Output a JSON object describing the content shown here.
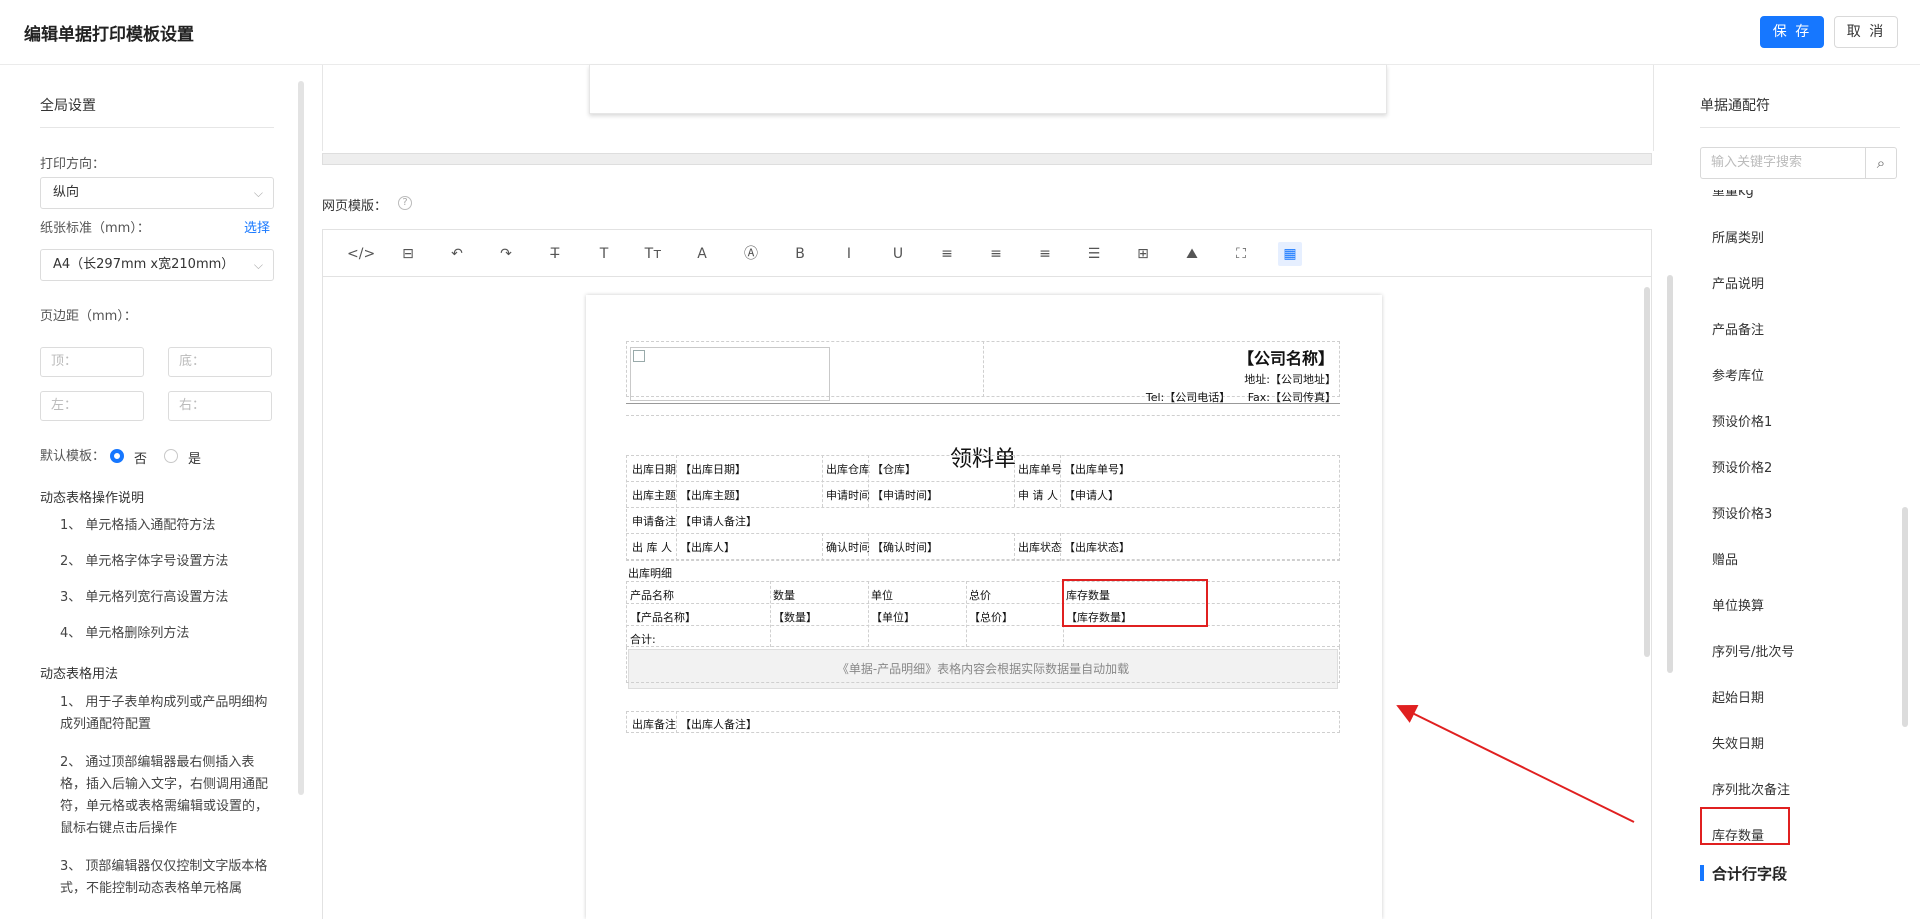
{
  "header": {
    "title": "编辑单据打印模板设置",
    "save_label": "保 存",
    "cancel_label": "取 消"
  },
  "left": {
    "section_title": "全局设置",
    "orientation_label": "打印方向：",
    "orientation_value": "纵向",
    "paper_label": "纸张标准（mm）：",
    "paper_link": "选择",
    "paper_value": "A4（长297mm x宽210mm）",
    "margin_label": "页边距（mm）：",
    "margin_top": "顶：",
    "margin_bottom": "底：",
    "margin_left": "左：",
    "margin_right": "右：",
    "default_label": "默认模板：",
    "default_no": "否",
    "default_yes": "是",
    "help1_title": "动态表格操作说明",
    "help1_items": [
      "1、 单元格插入通配符方法",
      "2、 单元格字体字号设置方法",
      "3、 单元格列宽行高设置方法",
      "4、 单元格删除列方法"
    ],
    "help2_title": "动态表格用法",
    "help2_items": [
      "1、 用于子表单构成列或产品明细构成列通配符配置",
      "2、 通过顶部编辑器最右侧插入表格，插入后输入文字，右侧调用通配符，单元格或表格需编辑或设置的，鼠标右键点击后操作",
      "3、 顶部编辑器仅仅控制文字版本格式，不能控制动态表格单元格属"
    ]
  },
  "middle": {
    "web_template_label": "网页模版：",
    "qmark": "?"
  },
  "toolbar_icons": [
    "code-icon",
    "template-icon",
    "undo-icon",
    "redo-icon",
    "strikethrough-icon",
    "text-icon",
    "font-size-icon",
    "font-color-icon",
    "bg-color-icon",
    "bold-icon",
    "italic-icon",
    "underline-icon",
    "align-left-icon",
    "align-center-icon",
    "align-right-icon",
    "justify-icon",
    "table-icon",
    "image-icon",
    "fullscreen-icon",
    "dynamic-table-icon"
  ],
  "toolbar_glyphs": [
    "</>",
    "⊟",
    "↶",
    "↷",
    "T̶",
    "T",
    "Tт",
    "A",
    "Ⓐ",
    "B",
    "I",
    "U",
    "≡",
    "≡",
    "≡",
    "☰",
    "⊞",
    "⛰",
    "⛶",
    "▦"
  ],
  "doc": {
    "company": "【公司名称】",
    "address": "地址:【公司地址】",
    "tel": "Tel:【公司电话】",
    "fax": "Fax:【公司传真】",
    "title": "领料单",
    "rows": [
      [
        "出库日期",
        "【出库日期】",
        "出库仓库",
        "【仓库】",
        "出库单号",
        "【出库单号】"
      ],
      [
        "出库主题",
        "【出库主题】",
        "申请时间",
        "【申请时间】",
        "申 请 人",
        "【申请人】"
      ],
      [
        "申请备注",
        "【申请人备注】",
        "",
        "",
        "",
        ""
      ],
      [
        "出 库 人",
        "【出库人】",
        "确认时间",
        "【确认时间】",
        "出库状态",
        "【出库状态】"
      ]
    ],
    "detail_label": "出库明细",
    "detail_headers": [
      "产品名称",
      "数量",
      "单位",
      "总价",
      "库存数量"
    ],
    "detail_values": [
      "【产品名称】",
      "【数量】",
      "【单位】",
      "【总价】",
      "【库存数量】"
    ],
    "total_label": "合计:",
    "auto_load_text": "《单据-产品明细》表格内容会根据实际数据量自动加载",
    "remark_label": "出库备注",
    "remark_value": "【出库人备注】"
  },
  "right": {
    "title": "单据通配符",
    "search_placeholder": "输入关键字搜索",
    "items": [
      "重量kg",
      "所属类别",
      "产品说明",
      "产品备注",
      "参考库位",
      "预设价格1",
      "预设价格2",
      "预设价格3",
      "赠品",
      "单位换算",
      "序列号/批次号",
      "起始日期",
      "失效日期",
      "序列批次备注",
      "库存数量"
    ],
    "section_name": "合计行字段"
  },
  "colors": {
    "accent": "#1677ff",
    "highlight": "#e02020"
  }
}
